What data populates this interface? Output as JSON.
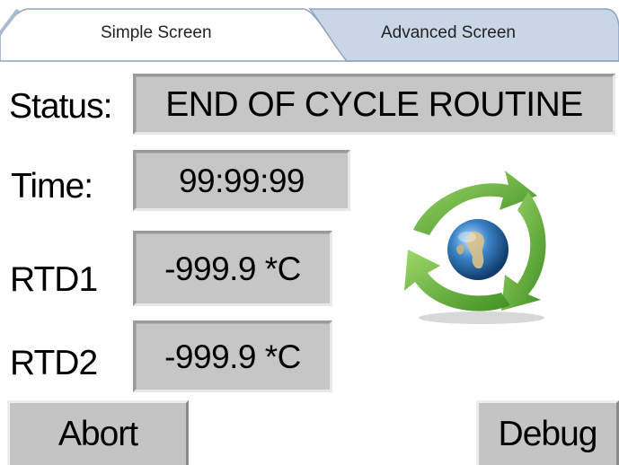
{
  "tabs": [
    {
      "label": "Simple Screen",
      "active": true
    },
    {
      "label": "Advanced Screen",
      "active": false
    }
  ],
  "status": {
    "label": "Status:",
    "value": "END OF CYCLE ROUTINE"
  },
  "time": {
    "label": "Time:",
    "value": "99:99:99"
  },
  "rtd1": {
    "label": "RTD1",
    "value": "-999.9 *C"
  },
  "rtd2": {
    "label": "RTD2",
    "value": "-999.9 *C"
  },
  "buttons": {
    "abort": "Abort",
    "debug": "Debug"
  },
  "logo": {
    "icon": "recycle-globe-icon"
  },
  "colors": {
    "panel": "#c6c6c6",
    "tab_inactive": "#c9d6e6",
    "logo_green": "#6db33f",
    "globe_blue": "#2a6fb0"
  }
}
